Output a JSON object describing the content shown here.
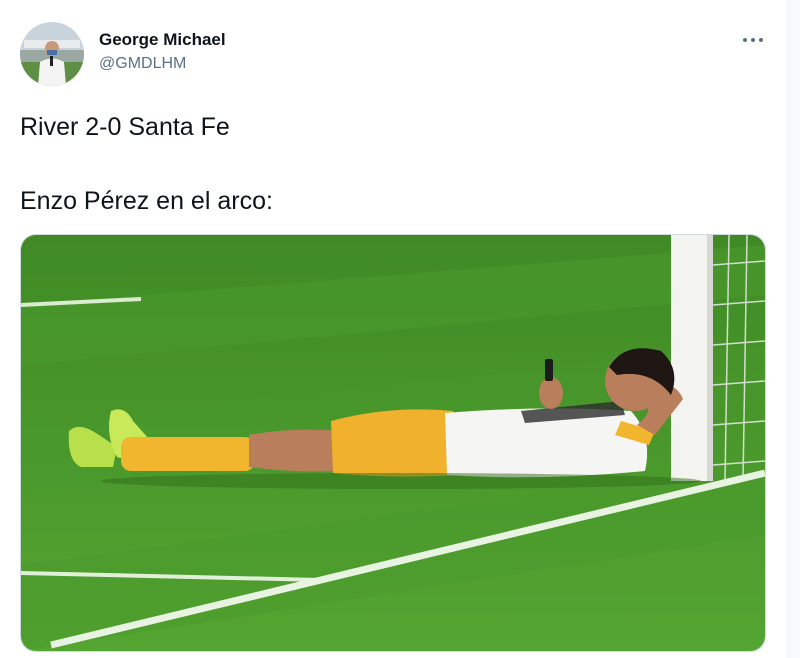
{
  "tweet": {
    "author": {
      "display_name": "George Michael",
      "handle": "@GMDLHM"
    },
    "text_lines": [
      "River 2-0 Santa Fe",
      "Enzo Pérez en el arco:"
    ],
    "more_icon": "more-horizontal-icon"
  },
  "colors": {
    "grass": "#4c9a2a",
    "kit_yellow": "#f2b62e",
    "handle_gray": "#5b7083"
  }
}
